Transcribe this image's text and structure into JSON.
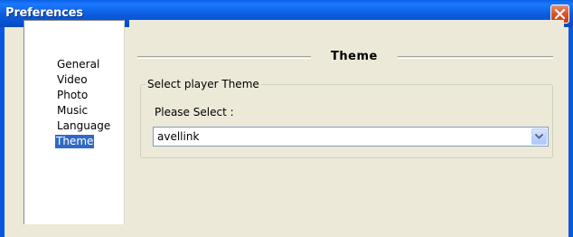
{
  "window": {
    "title": "Preferences",
    "close_icon": "close-icon",
    "colors": {
      "titlebar": "#0a5fe6",
      "client": "#ece9d8",
      "selection": "#316ac5",
      "close_button": "#d9542a"
    }
  },
  "sidebar": {
    "items": [
      {
        "label": "General",
        "selected": false
      },
      {
        "label": "Video",
        "selected": false
      },
      {
        "label": "Photo",
        "selected": false
      },
      {
        "label": "Music",
        "selected": false
      },
      {
        "label": "Language",
        "selected": false
      },
      {
        "label": "Theme",
        "selected": true
      }
    ]
  },
  "panel": {
    "header": "Theme",
    "group": {
      "legend": "Select player Theme",
      "prompt": "Please Select :",
      "dropdown": {
        "value": "avellink",
        "icon": "chevron-down-icon"
      }
    }
  }
}
